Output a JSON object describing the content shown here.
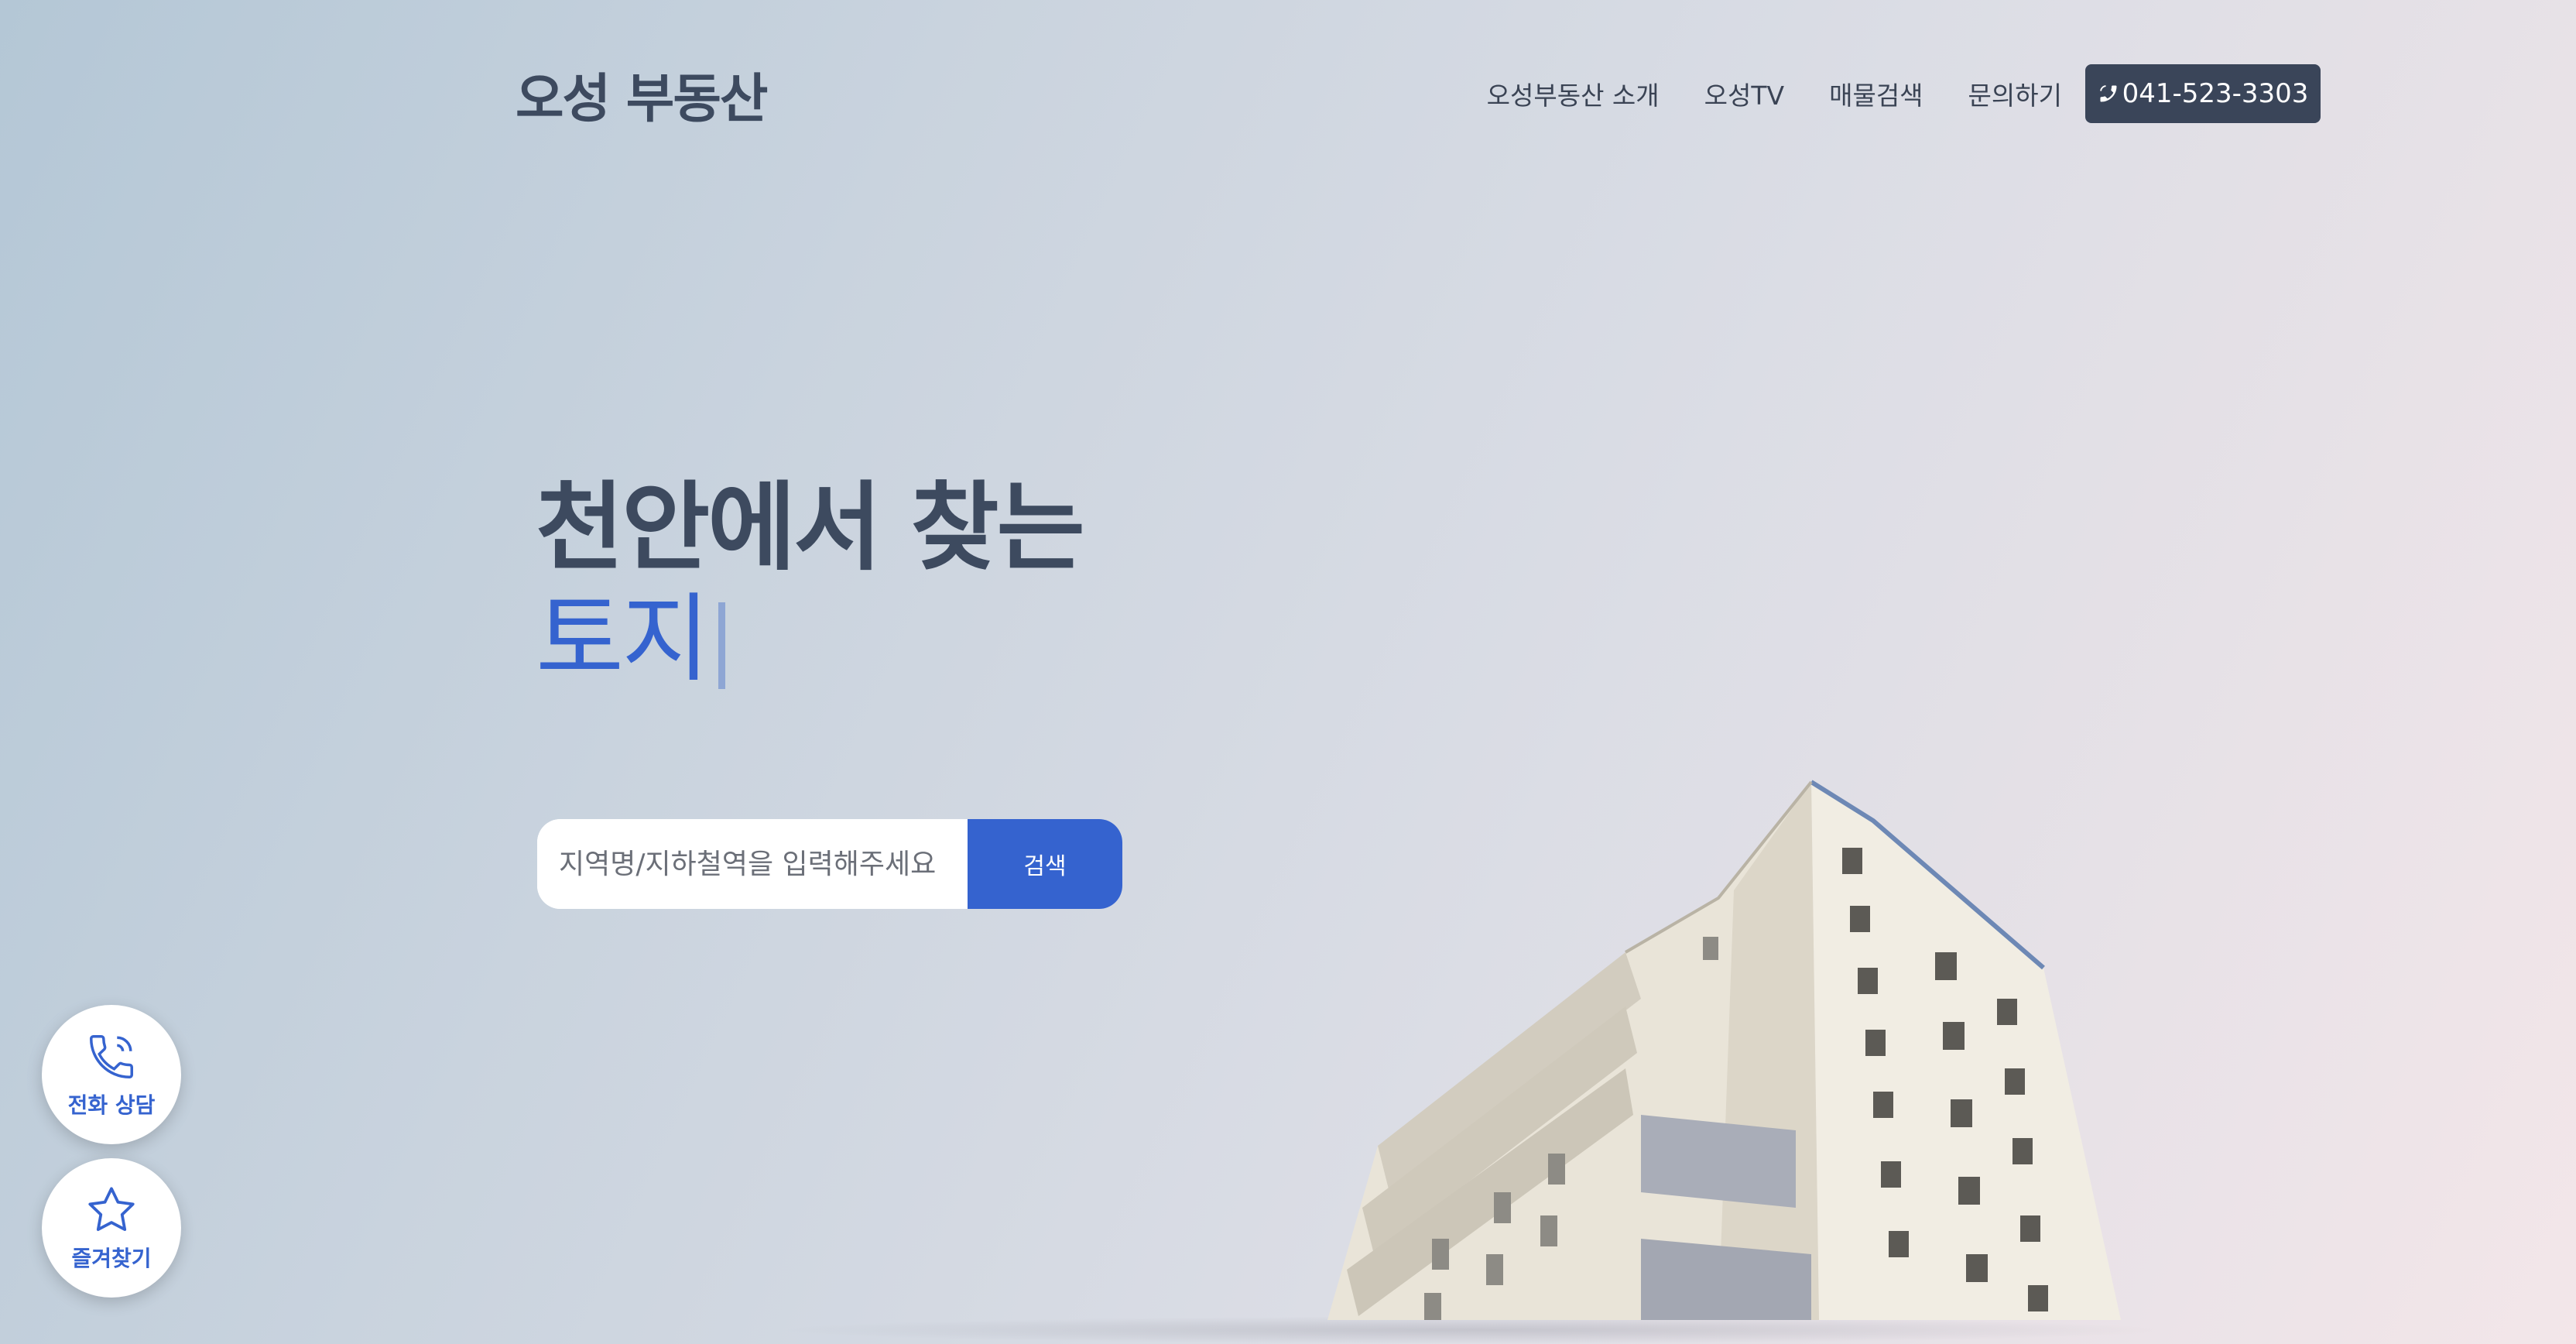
{
  "header": {
    "logo": "오성 부동산",
    "nav": [
      {
        "label": "오성부동산 소개"
      },
      {
        "label": "오성TV"
      },
      {
        "label": "매물검색"
      },
      {
        "label": "문의하기"
      }
    ],
    "phone": "041-523-3303"
  },
  "hero": {
    "line1": "천안에서 찾는",
    "line2": "토지"
  },
  "search": {
    "placeholder": "지역명/지하철역을 입력해주세요",
    "button": "검색"
  },
  "floating": {
    "call_label": "전화 상담",
    "bookmark_label": "즐겨찾기"
  },
  "colors": {
    "accent": "#3563cf",
    "dark": "#3a4559"
  },
  "icons": {
    "phone": "phone-icon",
    "call": "phone-ringing-icon",
    "bookmark": "star-icon"
  }
}
